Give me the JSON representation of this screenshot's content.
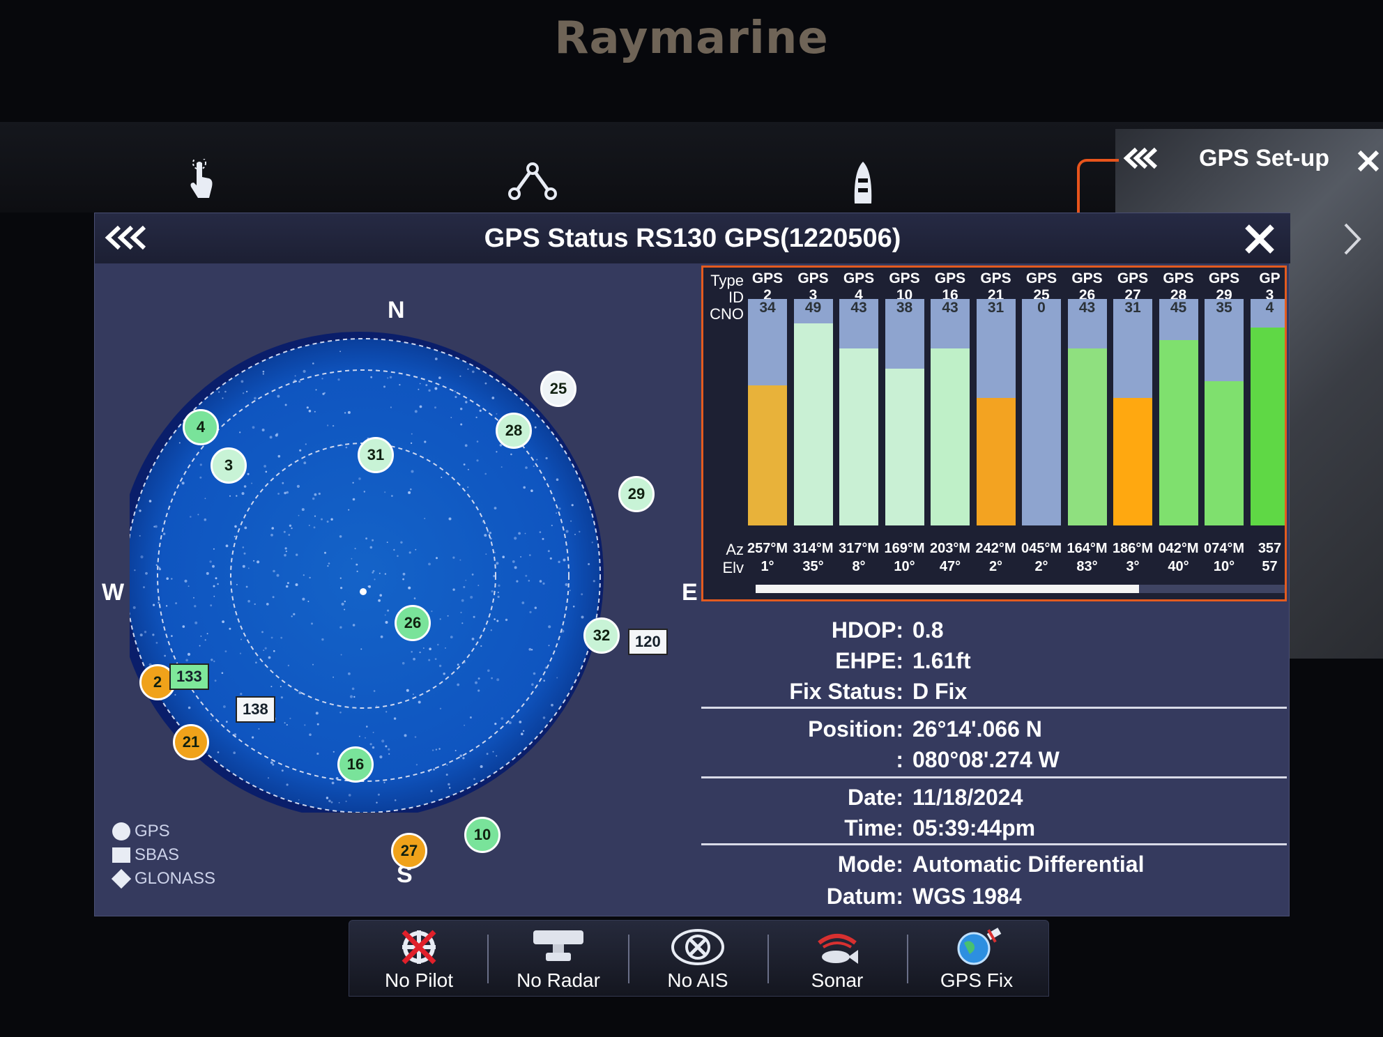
{
  "brand": "Raymarine",
  "toolbar": {
    "icons": [
      "hand-tap-icon",
      "route-icon",
      "boat-icon"
    ]
  },
  "side_panel": {
    "title": "GPS Set-up"
  },
  "window": {
    "title": "GPS Status RS130 GPS(1220506)"
  },
  "skyview": {
    "compass": {
      "north": "N",
      "south": "S",
      "east": "E",
      "west": "W"
    },
    "satellites": [
      {
        "id": "25",
        "status": "none"
      },
      {
        "id": "28",
        "status": "mid"
      },
      {
        "id": "4",
        "status": "strong"
      },
      {
        "id": "3",
        "status": "mid"
      },
      {
        "id": "31",
        "status": "mid"
      },
      {
        "id": "29",
        "status": "mid"
      },
      {
        "id": "26",
        "status": "strong"
      },
      {
        "id": "32",
        "status": "mid"
      },
      {
        "id": "2",
        "status": "weak"
      },
      {
        "id": "21",
        "status": "weak"
      },
      {
        "id": "16",
        "status": "strong"
      },
      {
        "id": "10",
        "status": "strong"
      },
      {
        "id": "27",
        "status": "weak"
      }
    ],
    "sbas": [
      {
        "id": "120",
        "color": "white"
      },
      {
        "id": "133",
        "color": "green"
      },
      {
        "id": "138",
        "color": "white"
      }
    ],
    "legend": [
      "GPS",
      "SBAS",
      "GLONASS"
    ]
  },
  "table": {
    "row_labels": {
      "type": "Type",
      "id": "ID",
      "cno": "CNO",
      "az": "Az",
      "elv": "Elv"
    },
    "columns": [
      {
        "type": "GPS",
        "id": "2",
        "cno": "34",
        "cno_value": 34,
        "color": "#e8b23a",
        "az": "257°M",
        "elv": "1°"
      },
      {
        "type": "GPS",
        "id": "3",
        "cno": "49",
        "cno_value": 49,
        "color": "#c9f0d4",
        "az": "314°M",
        "elv": "35°"
      },
      {
        "type": "GPS",
        "id": "4",
        "cno": "43",
        "cno_value": 43,
        "color": "#c9f0d4",
        "az": "317°M",
        "elv": "8°"
      },
      {
        "type": "GPS",
        "id": "10",
        "cno": "38",
        "cno_value": 38,
        "color": "#c9f0d4",
        "az": "169°M",
        "elv": "10°"
      },
      {
        "type": "GPS",
        "id": "16",
        "cno": "43",
        "cno_value": 43,
        "color": "#bff0c8",
        "az": "203°M",
        "elv": "47°"
      },
      {
        "type": "GPS",
        "id": "21",
        "cno": "31",
        "cno_value": 31,
        "color": "#f3a321",
        "az": "242°M",
        "elv": "2°"
      },
      {
        "type": "GPS",
        "id": "25",
        "cno": "0",
        "cno_value": 0,
        "color": "#c9f0d4",
        "az": "045°M",
        "elv": "2°"
      },
      {
        "type": "GPS",
        "id": "26",
        "cno": "43",
        "cno_value": 43,
        "color": "#8fe07f",
        "az": "164°M",
        "elv": "83°"
      },
      {
        "type": "GPS",
        "id": "27",
        "cno": "31",
        "cno_value": 31,
        "color": "#ffa810",
        "az": "186°M",
        "elv": "3°"
      },
      {
        "type": "GPS",
        "id": "28",
        "cno": "45",
        "cno_value": 45,
        "color": "#7fe06e",
        "az": "042°M",
        "elv": "40°"
      },
      {
        "type": "GPS",
        "id": "29",
        "cno": "35",
        "cno_value": 35,
        "color": "#7fe06e",
        "az": "074°M",
        "elv": "10°"
      },
      {
        "type": "GP",
        "id": "3",
        "cno": "4",
        "cno_value": 48,
        "color": "#5fd845",
        "az": "357",
        "elv": "57"
      }
    ],
    "cno_max": 55
  },
  "info": {
    "hdop": {
      "label": "HDOP:",
      "value": "0.8"
    },
    "ehpe": {
      "label": "EHPE:",
      "value": "1.61ft"
    },
    "fix": {
      "label": "Fix Status:",
      "value": "D Fix"
    },
    "position": {
      "label": "Position:",
      "lat": "26°14'.066 N",
      "lon_label": ":",
      "lon": "080°08'.274 W"
    },
    "date": {
      "label": "Date:",
      "value": "11/18/2024"
    },
    "time": {
      "label": "Time:",
      "value": "05:39:44pm"
    },
    "mode": {
      "label": "Mode:",
      "value": "Automatic Differential"
    },
    "datum": {
      "label": "Datum:",
      "value": "WGS 1984"
    }
  },
  "bottom_bar": [
    {
      "label": "No Pilot",
      "icon": "no-pilot-icon"
    },
    {
      "label": "No Radar",
      "icon": "radar-icon"
    },
    {
      "label": "No AIS",
      "icon": "ais-icon"
    },
    {
      "label": "Sonar",
      "icon": "sonar-fish-icon"
    },
    {
      "label": "GPS Fix",
      "icon": "gps-fix-icon"
    }
  ]
}
